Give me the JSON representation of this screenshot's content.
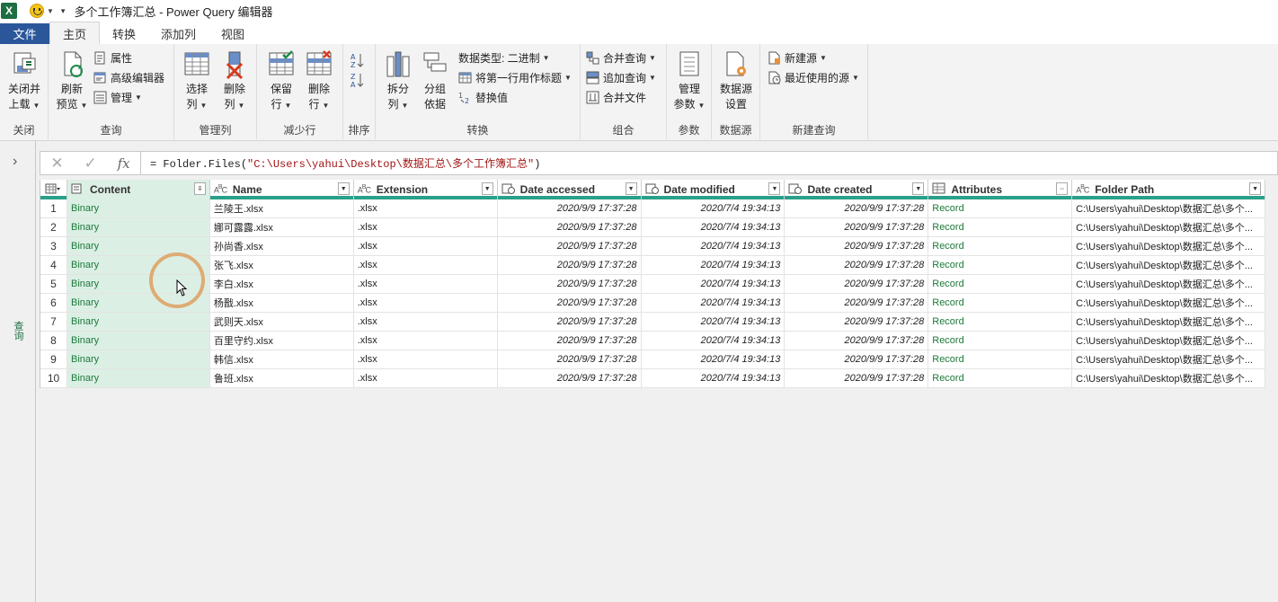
{
  "app": {
    "logo": "X",
    "title": "多个工作簿汇总 - Power Query 编辑器"
  },
  "tabs": [
    {
      "label": "文件"
    },
    {
      "label": "主页"
    },
    {
      "label": "转换"
    },
    {
      "label": "添加列"
    },
    {
      "label": "视图"
    }
  ],
  "ribbon": {
    "close": {
      "btn1": "关闭并",
      "btn1b": "上载",
      "group": "关闭"
    },
    "query": {
      "refresh1": "刷新",
      "refresh2": "预览",
      "props": "属性",
      "adv": "高级编辑器",
      "manage": "管理",
      "group": "查询"
    },
    "cols": {
      "choose1": "选择",
      "choose2": "列",
      "remove1": "删除",
      "remove2": "列",
      "group": "管理列"
    },
    "rows": {
      "keep1": "保留",
      "keep2": "行",
      "remove1": "删除",
      "remove2": "行",
      "group": "减少行"
    },
    "sort": {
      "group": "排序"
    },
    "transform": {
      "split1": "拆分",
      "split2": "列",
      "group1": "分组",
      "group2": "依据",
      "dtype": "数据类型: 二进制",
      "firstrow": "将第一行用作标题",
      "replace": "替换值",
      "group": "转换"
    },
    "combine": {
      "merge": "合并查询",
      "append": "追加查询",
      "files": "合并文件",
      "group": "组合"
    },
    "params": {
      "m1": "管理",
      "m2": "参数",
      "group": "参数"
    },
    "source": {
      "s1": "数据源",
      "s2": "设置",
      "group": "数据源"
    },
    "newq": {
      "new": "新建源",
      "recent": "最近使用的源",
      "group": "新建查询"
    }
  },
  "formula": {
    "prefix": "= Folder.Files(",
    "arg": "\"C:\\Users\\yahui\\Desktop\\数据汇总\\多个工作簿汇总\"",
    "suffix": ")"
  },
  "side": {
    "label": "查询"
  },
  "columns": [
    {
      "type": "doc",
      "name": "Content"
    },
    {
      "type": "ABC",
      "name": "Name"
    },
    {
      "type": "ABC",
      "name": "Extension"
    },
    {
      "type": "cal",
      "name": "Date accessed"
    },
    {
      "type": "cal",
      "name": "Date modified"
    },
    {
      "type": "cal",
      "name": "Date created"
    },
    {
      "type": "tbl",
      "name": "Attributes"
    },
    {
      "type": "ABC",
      "name": "Folder Path"
    }
  ],
  "rows": [
    {
      "n": "1",
      "content": "Binary",
      "name": "兰陵王.xlsx",
      "ext": ".xlsx",
      "acc": "2020/9/9 17:37:28",
      "mod": "2020/7/4 19:34:13",
      "cre": "2020/9/9 17:37:28",
      "attr": "Record",
      "path": "C:\\Users\\yahui\\Desktop\\数据汇总\\多个..."
    },
    {
      "n": "2",
      "content": "Binary",
      "name": "娜可露露.xlsx",
      "ext": ".xlsx",
      "acc": "2020/9/9 17:37:28",
      "mod": "2020/7/4 19:34:13",
      "cre": "2020/9/9 17:37:28",
      "attr": "Record",
      "path": "C:\\Users\\yahui\\Desktop\\数据汇总\\多个..."
    },
    {
      "n": "3",
      "content": "Binary",
      "name": "孙尚香.xlsx",
      "ext": ".xlsx",
      "acc": "2020/9/9 17:37:28",
      "mod": "2020/7/4 19:34:13",
      "cre": "2020/9/9 17:37:28",
      "attr": "Record",
      "path": "C:\\Users\\yahui\\Desktop\\数据汇总\\多个..."
    },
    {
      "n": "4",
      "content": "Binary",
      "name": "张飞.xlsx",
      "ext": ".xlsx",
      "acc": "2020/9/9 17:37:28",
      "mod": "2020/7/4 19:34:13",
      "cre": "2020/9/9 17:37:28",
      "attr": "Record",
      "path": "C:\\Users\\yahui\\Desktop\\数据汇总\\多个..."
    },
    {
      "n": "5",
      "content": "Binary",
      "name": "李白.xlsx",
      "ext": ".xlsx",
      "acc": "2020/9/9 17:37:28",
      "mod": "2020/7/4 19:34:13",
      "cre": "2020/9/9 17:37:28",
      "attr": "Record",
      "path": "C:\\Users\\yahui\\Desktop\\数据汇总\\多个..."
    },
    {
      "n": "6",
      "content": "Binary",
      "name": "杨戬.xlsx",
      "ext": ".xlsx",
      "acc": "2020/9/9 17:37:28",
      "mod": "2020/7/4 19:34:13",
      "cre": "2020/9/9 17:37:28",
      "attr": "Record",
      "path": "C:\\Users\\yahui\\Desktop\\数据汇总\\多个..."
    },
    {
      "n": "7",
      "content": "Binary",
      "name": "武则天.xlsx",
      "ext": ".xlsx",
      "acc": "2020/9/9 17:37:28",
      "mod": "2020/7/4 19:34:13",
      "cre": "2020/9/9 17:37:28",
      "attr": "Record",
      "path": "C:\\Users\\yahui\\Desktop\\数据汇总\\多个..."
    },
    {
      "n": "8",
      "content": "Binary",
      "name": "百里守约.xlsx",
      "ext": ".xlsx",
      "acc": "2020/9/9 17:37:28",
      "mod": "2020/7/4 19:34:13",
      "cre": "2020/9/9 17:37:28",
      "attr": "Record",
      "path": "C:\\Users\\yahui\\Desktop\\数据汇总\\多个..."
    },
    {
      "n": "9",
      "content": "Binary",
      "name": "韩信.xlsx",
      "ext": ".xlsx",
      "acc": "2020/9/9 17:37:28",
      "mod": "2020/7/4 19:34:13",
      "cre": "2020/9/9 17:37:28",
      "attr": "Record",
      "path": "C:\\Users\\yahui\\Desktop\\数据汇总\\多个..."
    },
    {
      "n": "10",
      "content": "Binary",
      "name": "鲁班.xlsx",
      "ext": ".xlsx",
      "acc": "2020/9/9 17:37:28",
      "mod": "2020/7/4 19:34:13",
      "cre": "2020/9/9 17:37:28",
      "attr": "Record",
      "path": "C:\\Users\\yahui\\Desktop\\数据汇总\\多个..."
    }
  ],
  "colors": {
    "accent": "#2b579a",
    "header_bar": "#2aa08a",
    "selected_col": "#dcefe5",
    "excel_green": "#1d6f42"
  }
}
